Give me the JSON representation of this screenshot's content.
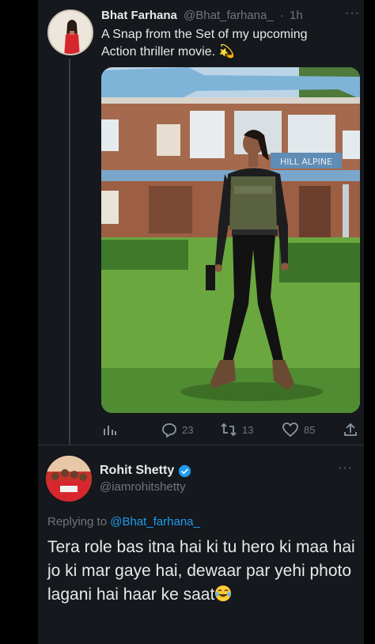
{
  "original_tweet": {
    "author_name": "Bhat Farhana",
    "handle": "@Bhat_farhana_",
    "separator": "·",
    "time": "1h",
    "text": "A Snap from the Set of my upcoming Action thriller movie.",
    "emoji": "💫",
    "media_sign_text": "HILL ALPINE",
    "stats": {
      "replies": "23",
      "retweets": "13",
      "likes": "85"
    }
  },
  "reply_tweet": {
    "author_name": "Rohit Shetty",
    "verified": true,
    "handle": "@iamrohitshetty",
    "replying_label": "Replying to",
    "replying_to": "@Bhat_farhana_",
    "text": "Tera role bas itna hai ki tu hero ki maa hai jo ki mar gaye hai, dewaar par yehi photo lagani hai haar ke saat"
  },
  "icons": [
    "more-options-icon",
    "analytics-icon",
    "reply-icon",
    "retweet-icon",
    "like-icon",
    "share-icon",
    "verified-badge-icon",
    "tears-of-joy-emoji"
  ],
  "colors": {
    "background": "#000000",
    "panel": "#15181c",
    "text_primary": "#e7e9ea",
    "text_secondary": "#71767b",
    "accent": "#1d9bf0"
  }
}
